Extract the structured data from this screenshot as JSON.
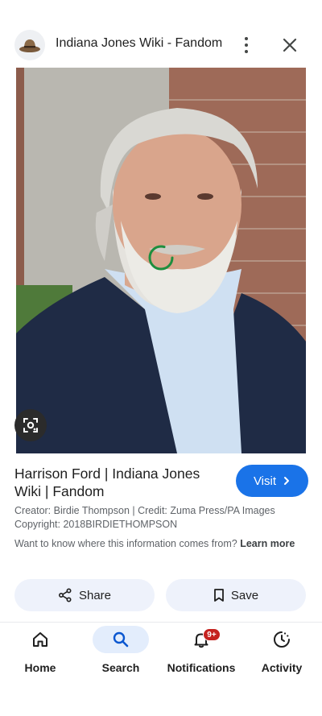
{
  "header": {
    "site_icon": "fedora-hat-icon",
    "title": "Indiana Jones Wiki - Fandom",
    "more_icon": "more-vertical-icon",
    "close_icon": "close-icon"
  },
  "image": {
    "lens_icon": "lens-search-icon"
  },
  "result": {
    "title": "Harrison Ford | Indiana Jones Wiki | Fandom",
    "visit_label": "Visit",
    "creator_line": "Creator: Birdie Thompson | Credit: Zuma Press/PA Images",
    "copyright_line": "Copyright: 2018BIRDIETHOMPSON",
    "info_question": "Want to know where this information comes from?",
    "learn_more": "Learn more"
  },
  "actions": {
    "share_label": "Share",
    "save_label": "Save"
  },
  "nav": {
    "items": [
      {
        "label": "Home",
        "icon": "home-icon"
      },
      {
        "label": "Search",
        "icon": "search-icon",
        "active": true
      },
      {
        "label": "Notifications",
        "icon": "bell-icon",
        "badge": "9+"
      },
      {
        "label": "Activity",
        "icon": "activity-icon"
      }
    ]
  },
  "colors": {
    "accent": "#1a73e8",
    "badge": "#c5221f",
    "chip_bg": "#eef2fb",
    "active_nav_bg": "#e3edfc"
  }
}
